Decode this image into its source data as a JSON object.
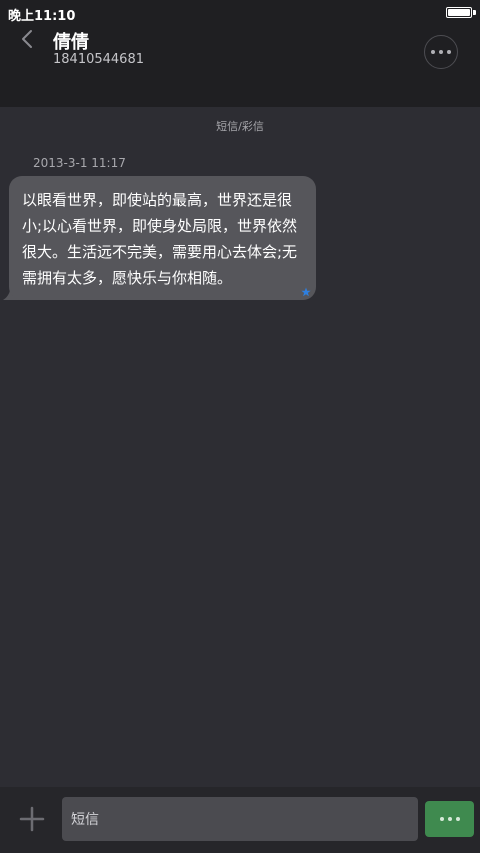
{
  "status_bar": {
    "time": "晚上11:10",
    "battery_level": 1.0
  },
  "header": {
    "contact_name": "倩倩",
    "contact_number": "18410544681",
    "back_icon": "chevron-left-icon",
    "more_icon": "more-dots-icon"
  },
  "conversation": {
    "type_label": "短信/彩信",
    "messages": [
      {
        "timestamp": "2013-3-1 11:17",
        "text": "以眼看世界，即使站的最高，世界还是很小;以心看世界，即使身处局限，世界依然很大。生活远不完美，需要用心去体会;无需拥有太多，愿快乐与你相随。",
        "direction": "incoming",
        "marker_icon": "star-icon"
      }
    ]
  },
  "composer": {
    "placeholder": "短信",
    "add_icon": "plus-icon",
    "send_icon": "more-dots-icon"
  },
  "colors": {
    "background": "#2d2d33",
    "header_background": "#1f1f22",
    "bubble": "#56565b",
    "send_button": "#3f8a4f",
    "star": "#2e7fe0"
  }
}
